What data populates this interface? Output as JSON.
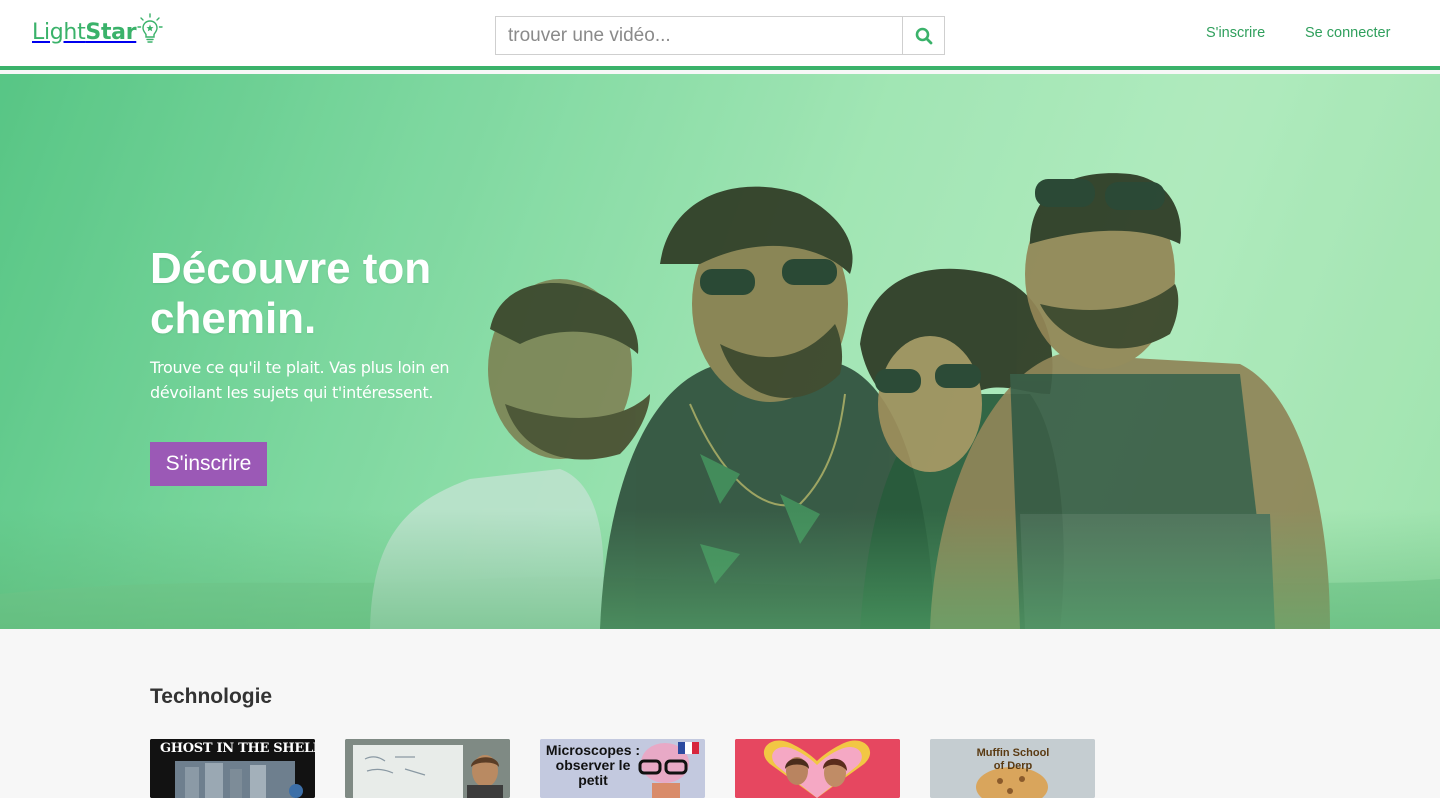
{
  "header": {
    "logo_light": "Light",
    "logo_star": "Star",
    "search_placeholder": "trouver une vidéo...",
    "signup_link": "S'inscrire",
    "login_link": "Se connecter"
  },
  "hero": {
    "title": "Découvre ton chemin.",
    "subtitle": "Trouve ce qu'il te plait. Vas plus loin en dévoilant les sujets qui t'intéressent.",
    "cta": "S'inscrire"
  },
  "section": {
    "title": "Technologie",
    "thumbnails": [
      {
        "caption": "GHOST IN THE SHELL"
      },
      {
        "caption": ""
      },
      {
        "caption": "Microscopes : observer le petit"
      },
      {
        "caption": ""
      },
      {
        "caption": "Muffin School of Derp"
      }
    ]
  },
  "colors": {
    "brand_green": "#3ab26a",
    "cta_purple": "#9b59b6"
  },
  "icons": {
    "search": "search-icon",
    "logo": "lightbulb-icon"
  }
}
